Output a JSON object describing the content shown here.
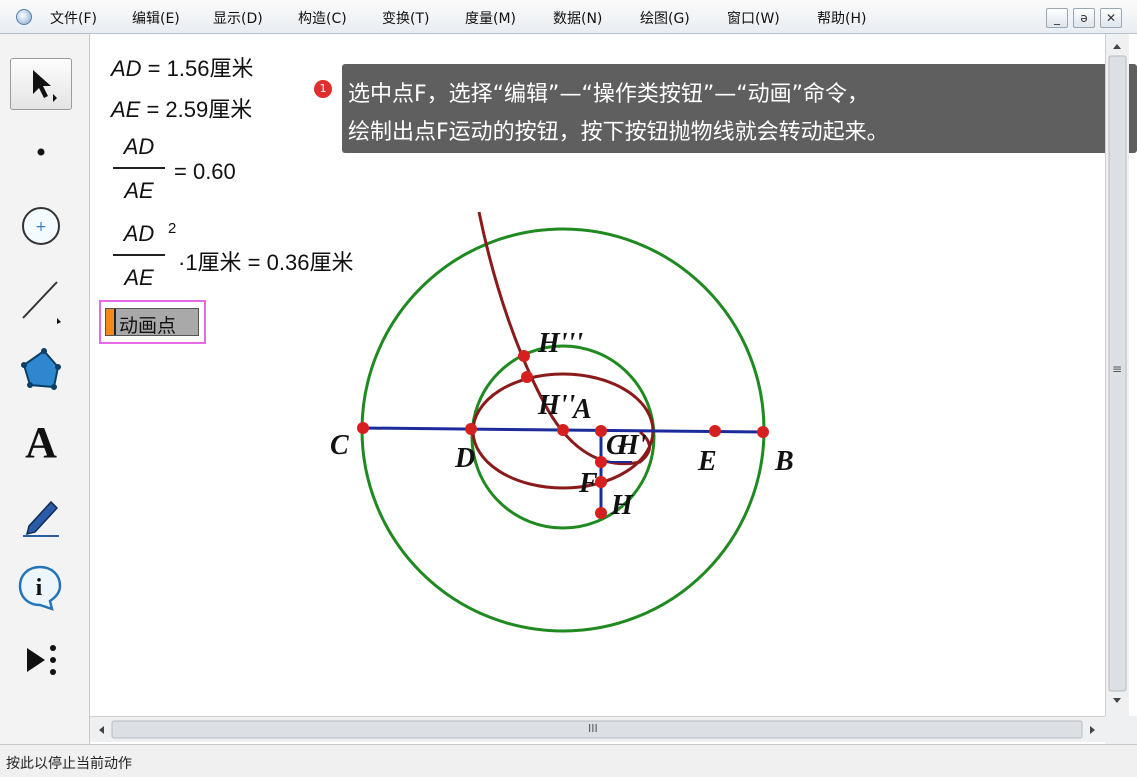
{
  "menu": [
    "文件(F)",
    "编辑(E)",
    "显示(D)",
    "构造(C)",
    "变换(T)",
    "度量(M)",
    "数据(N)",
    "绘图(G)",
    "窗口(W)",
    "帮助(H)"
  ],
  "window_controls": {
    "minimize": "_",
    "restore": "ə",
    "close": "✕"
  },
  "tools": [
    {
      "name": "arrow-select-tool",
      "icon": "arrow-icon"
    },
    {
      "name": "point-tool",
      "icon": "point-icon"
    },
    {
      "name": "compass-tool",
      "icon": "circle-icon"
    },
    {
      "name": "straightedge-tool",
      "icon": "line-icon"
    },
    {
      "name": "polygon-tool",
      "icon": "polygon-icon"
    },
    {
      "name": "text-tool",
      "icon": "text-A-icon",
      "label": "A"
    },
    {
      "name": "marker-tool",
      "icon": "pen-icon"
    },
    {
      "name": "information-tool",
      "icon": "info-icon",
      "label": "i"
    },
    {
      "name": "custom-tool",
      "icon": "play-more-icon"
    }
  ],
  "measurements": {
    "ad_label": "AD",
    "ad_value": " = 1.56厘米",
    "ae_label": "AE",
    "ae_value": " = 2.59厘米",
    "ratio_num": "AD",
    "ratio_den": "AE",
    "ratio_value": "= 0.60",
    "sq_num": "AD",
    "sq_exp": "2",
    "sq_den": "AE",
    "sq_value": "·1厘米 = 0.36厘米"
  },
  "animation_button": {
    "label": "动画点"
  },
  "callout": {
    "badge": "1",
    "line1": "选中点F，选择“编辑”—“操作类按钮”—“动画”命令，",
    "line2": "绘制出点F运动的按钮，按下按钮抛物线就会转动起来。"
  },
  "point_labels": {
    "C": "C",
    "D": "D",
    "A": "A",
    "G": "G",
    "H_prime": "H'",
    "E": "E",
    "B": "B",
    "F": "F",
    "H": "H",
    "H_double": "H''",
    "H_triple": "H'''"
  },
  "colors": {
    "outer_circle": "#1f8a1f",
    "inner_circle": "#1f8a1f",
    "line": "#1c2a9c",
    "curve": "#8b1a1a",
    "point": "#d61f1f",
    "highlight": "#e46be4"
  },
  "status": "按此以停止当前动作",
  "hscroll_grip": "III",
  "vscroll_grip": "≡"
}
